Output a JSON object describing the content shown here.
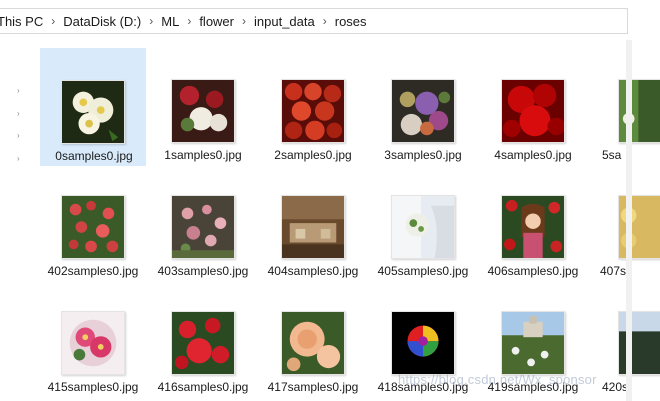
{
  "breadcrumb": [
    "This PC",
    "DataDisk (D:)",
    "ML",
    "flower",
    "input_data",
    "roses"
  ],
  "files": {
    "row1": [
      "0samples0.jpg",
      "1samples0.jpg",
      "2samples0.jpg",
      "3samples0.jpg",
      "4samples0.jpg",
      "5sa"
    ],
    "row2": [
      "402samples0.jpg",
      "403samples0.jpg",
      "404samples0.jpg",
      "405samples0.jpg",
      "406samples0.jpg",
      "407s"
    ],
    "row3": [
      "415samples0.jpg",
      "416samples0.jpg",
      "417samples0.jpg",
      "418samples0.jpg",
      "419samples0.jpg",
      "420s"
    ]
  },
  "selected_file": "0samples0.jpg",
  "watermark": "https://blog.csdn.net/Wx_sponsor",
  "colors": {
    "selection": "#d9ebfb",
    "border": "#d9d9d9"
  }
}
